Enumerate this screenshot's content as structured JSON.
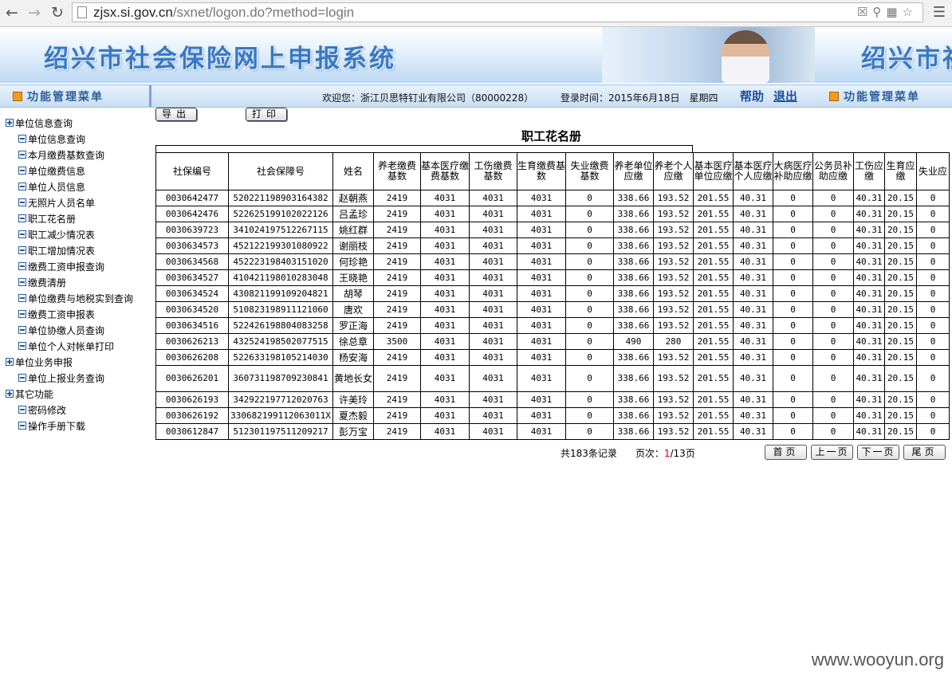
{
  "browser": {
    "url_host": "zjsx.si.gov.cn",
    "url_path": "/sxnet/logon.do?method=login"
  },
  "banner": {
    "title": "绍兴市社会保险网上申报系统",
    "title_repeat": "绍兴市社"
  },
  "menubar": {
    "left_header": "功能管理菜单",
    "welcome": "欢迎您：浙江贝思特钉业有限公司（80000228）",
    "login_time": "登录时间：2015年6月18日　星期四",
    "help": "帮助",
    "logout": "退出",
    "right_header": "功能管理菜单"
  },
  "sidebar": {
    "items": [
      {
        "label": "单位信息查询",
        "level": 0
      },
      {
        "label": "单位信息查询",
        "level": 1
      },
      {
        "label": "本月缴费基数查询",
        "level": 1
      },
      {
        "label": "单位缴费信息",
        "level": 1
      },
      {
        "label": "单位人员信息",
        "level": 1
      },
      {
        "label": "无照片人员名单",
        "level": 1
      },
      {
        "label": "职工花名册",
        "level": 1
      },
      {
        "label": "职工减少情况表",
        "level": 1
      },
      {
        "label": "职工增加情况表",
        "level": 1
      },
      {
        "label": "缴费工资申报查询",
        "level": 1
      },
      {
        "label": "缴费清册",
        "level": 1
      },
      {
        "label": "单位缴费与地税实到查询",
        "level": 1
      },
      {
        "label": "缴费工资申报表",
        "level": 1
      },
      {
        "label": "单位协缴人员查询",
        "level": 1
      },
      {
        "label": "单位个人对帐单打印",
        "level": 1
      },
      {
        "label": "单位业务申报",
        "level": 0
      },
      {
        "label": "单位上报业务查询",
        "level": 1
      },
      {
        "label": "其它功能",
        "level": 0
      },
      {
        "label": "密码修改",
        "level": 1
      },
      {
        "label": "操作手册下载",
        "level": 1
      }
    ]
  },
  "toolbar": {
    "export_label": "导出",
    "print_label": "打印"
  },
  "page_title": "职工花名册",
  "table": {
    "headers": [
      "社保编号",
      "社会保障号",
      "姓名",
      "养老缴费基数",
      "基本医疗缴费基数",
      "工伤缴费基数",
      "生育缴费基数",
      "失业缴费基数",
      "养老单位应缴",
      "养老个人应缴",
      "基本医疗单位应缴",
      "基本医疗个人应缴",
      "大病医疗补助应缴",
      "公务员补助应缴",
      "工伤应缴",
      "生育应缴",
      "失业应"
    ],
    "rows": [
      [
        "0030642477",
        "520221198903164382",
        "赵朝燕",
        "2419",
        "4031",
        "4031",
        "4031",
        "0",
        "338.66",
        "193.52",
        "201.55",
        "40.31",
        "0",
        "0",
        "40.31",
        "20.15",
        "0"
      ],
      [
        "0030642476",
        "522625199102022126",
        "吕孟珍",
        "2419",
        "4031",
        "4031",
        "4031",
        "0",
        "338.66",
        "193.52",
        "201.55",
        "40.31",
        "0",
        "0",
        "40.31",
        "20.15",
        "0"
      ],
      [
        "0030639723",
        "341024197512267115",
        "姚红群",
        "2419",
        "4031",
        "4031",
        "4031",
        "0",
        "338.66",
        "193.52",
        "201.55",
        "40.31",
        "0",
        "0",
        "40.31",
        "20.15",
        "0"
      ],
      [
        "0030634573",
        "452122199301080922",
        "谢丽枝",
        "2419",
        "4031",
        "4031",
        "4031",
        "0",
        "338.66",
        "193.52",
        "201.55",
        "40.31",
        "0",
        "0",
        "40.31",
        "20.15",
        "0"
      ],
      [
        "0030634568",
        "452223198403151020",
        "何珍艳",
        "2419",
        "4031",
        "4031",
        "4031",
        "0",
        "338.66",
        "193.52",
        "201.55",
        "40.31",
        "0",
        "0",
        "40.31",
        "20.15",
        "0"
      ],
      [
        "0030634527",
        "410421198010283048",
        "王晓艳",
        "2419",
        "4031",
        "4031",
        "4031",
        "0",
        "338.66",
        "193.52",
        "201.55",
        "40.31",
        "0",
        "0",
        "40.31",
        "20.15",
        "0"
      ],
      [
        "0030634524",
        "430821199109204821",
        "胡琴",
        "2419",
        "4031",
        "4031",
        "4031",
        "0",
        "338.66",
        "193.52",
        "201.55",
        "40.31",
        "0",
        "0",
        "40.31",
        "20.15",
        "0"
      ],
      [
        "0030634520",
        "510823198911121060",
        "唐欢",
        "2419",
        "4031",
        "4031",
        "4031",
        "0",
        "338.66",
        "193.52",
        "201.55",
        "40.31",
        "0",
        "0",
        "40.31",
        "20.15",
        "0"
      ],
      [
        "0030634516",
        "522426198804083258",
        "罗正海",
        "2419",
        "4031",
        "4031",
        "4031",
        "0",
        "338.66",
        "193.52",
        "201.55",
        "40.31",
        "0",
        "0",
        "40.31",
        "20.15",
        "0"
      ],
      [
        "0030626213",
        "432524198502077515",
        "徐总章",
        "3500",
        "4031",
        "4031",
        "4031",
        "0",
        "490",
        "280",
        "201.55",
        "40.31",
        "0",
        "0",
        "40.31",
        "20.15",
        "0"
      ],
      [
        "0030626208",
        "522633198105214030",
        "杨安海",
        "2419",
        "4031",
        "4031",
        "4031",
        "0",
        "338.66",
        "193.52",
        "201.55",
        "40.31",
        "0",
        "0",
        "40.31",
        "20.15",
        "0"
      ],
      [
        "0030626201",
        "360731198709230841",
        "黄地长女",
        "2419",
        "4031",
        "4031",
        "4031",
        "0",
        "338.66",
        "193.52",
        "201.55",
        "40.31",
        "0",
        "0",
        "40.31",
        "20.15",
        "0"
      ],
      [
        "0030626193",
        "342922197712020763",
        "许美玲",
        "2419",
        "4031",
        "4031",
        "4031",
        "0",
        "338.66",
        "193.52",
        "201.55",
        "40.31",
        "0",
        "0",
        "40.31",
        "20.15",
        "0"
      ],
      [
        "0030626192",
        "330682199112063011X",
        "夏杰毅",
        "2419",
        "4031",
        "4031",
        "4031",
        "0",
        "338.66",
        "193.52",
        "201.55",
        "40.31",
        "0",
        "0",
        "40.31",
        "20.15",
        "0"
      ],
      [
        "0030612847",
        "512301197511209217",
        "彭万宝",
        "2419",
        "4031",
        "4031",
        "4031",
        "0",
        "338.66",
        "193.52",
        "201.55",
        "40.31",
        "0",
        "0",
        "40.31",
        "20.15",
        "0"
      ]
    ]
  },
  "pager": {
    "total_prefix": "共",
    "total": "183",
    "total_suffix": "条记录",
    "page_prefix": "页次：",
    "current_page": "1",
    "page_sep": "/",
    "total_pages": "13",
    "page_suffix": "页",
    "first_label": "首页",
    "prev_label": "上一页",
    "next_label": "下一页",
    "last_label": "尾页"
  },
  "watermark": "www.wooyun.org"
}
